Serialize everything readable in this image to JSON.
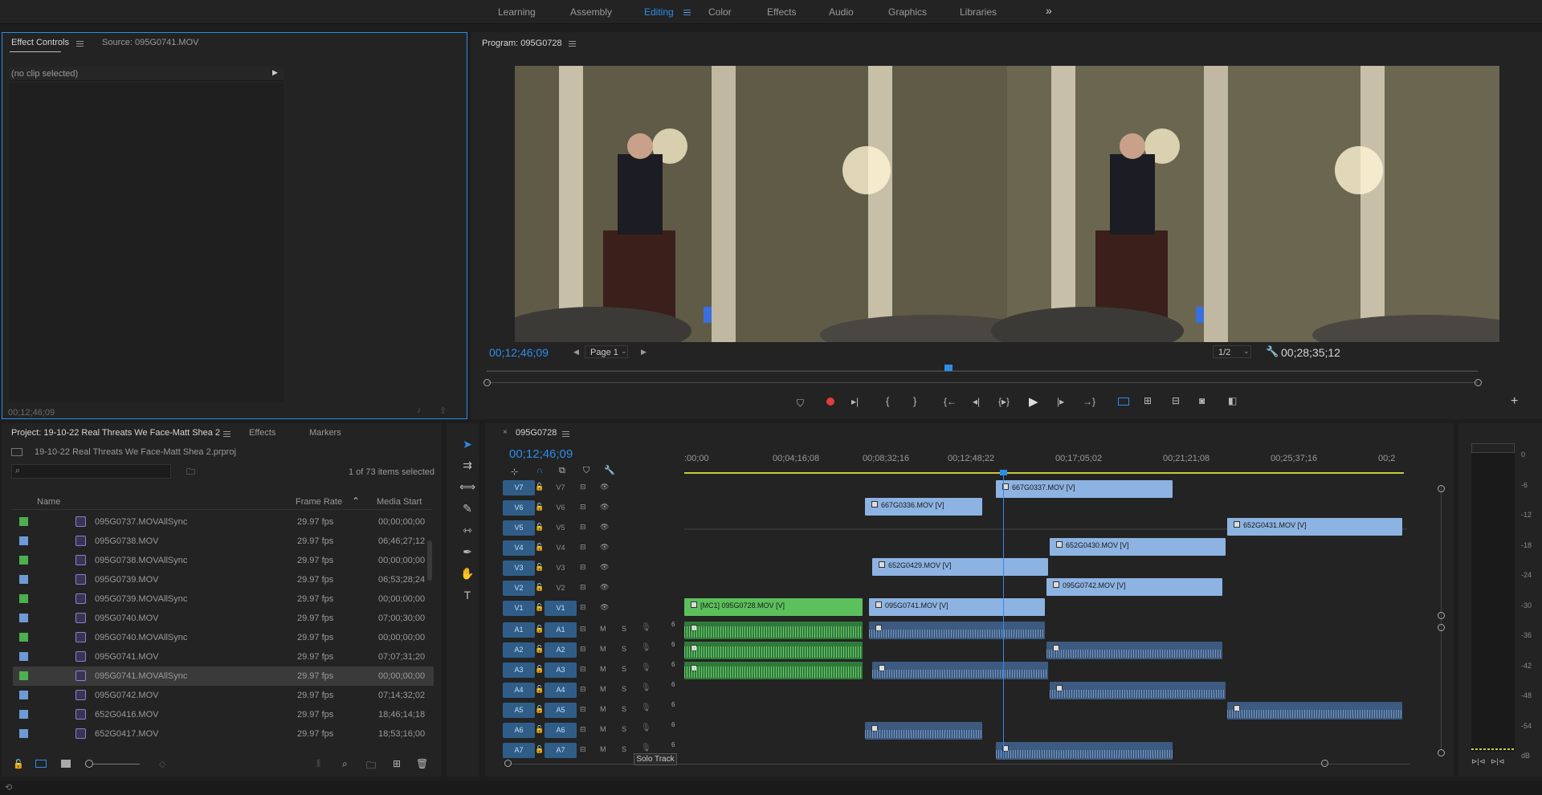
{
  "workspace_tabs": [
    "Learning",
    "Assembly",
    "Editing",
    "Color",
    "Effects",
    "Audio",
    "Graphics",
    "Libraries"
  ],
  "workspace_active": "Editing",
  "workspace_more": "»",
  "effect_controls": {
    "tab_label": "Effect Controls",
    "source_tab": "Source: 095G0741.MOV",
    "no_clip": "(no clip selected)",
    "timecode": "00;12;46;09"
  },
  "program": {
    "title": "Program: 095G0728",
    "timecode_left": "00;12;46;09",
    "page": "Page 1",
    "resolution": "1/2",
    "timecode_right": "00;28;35;12"
  },
  "project": {
    "tab_label": "Project: 19-10-22 Real Threats We Face-Matt Shea 2",
    "effects_tab": "Effects",
    "markers_tab": "Markers",
    "file_name": "19-10-22 Real Threats We Face-Matt Shea 2.prproj",
    "selected_count": "1 of 73 items selected",
    "columns": {
      "name": "Name",
      "frame_rate": "Frame Rate",
      "media_start": "Media Start"
    },
    "rows": [
      {
        "name": "095G0737.MOVAllSync",
        "fps": "29.97 fps",
        "start": "00;00;00;00",
        "color": "#4caf50",
        "sel": false
      },
      {
        "name": "095G0738.MOV",
        "fps": "29.97 fps",
        "start": "06;46;27;12",
        "color": "#6e9ad6",
        "sel": false
      },
      {
        "name": "095G0738.MOVAllSync",
        "fps": "29.97 fps",
        "start": "00;00;00;00",
        "color": "#4caf50",
        "sel": false
      },
      {
        "name": "095G0739.MOV",
        "fps": "29.97 fps",
        "start": "06;53;28;24",
        "color": "#6e9ad6",
        "sel": false
      },
      {
        "name": "095G0739.MOVAllSync",
        "fps": "29.97 fps",
        "start": "00;00;00;00",
        "color": "#4caf50",
        "sel": false
      },
      {
        "name": "095G0740.MOV",
        "fps": "29.97 fps",
        "start": "07;00;30;00",
        "color": "#6e9ad6",
        "sel": false
      },
      {
        "name": "095G0740.MOVAllSync",
        "fps": "29.97 fps",
        "start": "00;00;00;00",
        "color": "#4caf50",
        "sel": false
      },
      {
        "name": "095G0741.MOV",
        "fps": "29.97 fps",
        "start": "07;07;31;20",
        "color": "#6e9ad6",
        "sel": false
      },
      {
        "name": "095G0741.MOVAllSync",
        "fps": "29.97 fps",
        "start": "00;00;00;00",
        "color": "#4caf50",
        "sel": true
      },
      {
        "name": "095G0742.MOV",
        "fps": "29.97 fps",
        "start": "07;14;32;02",
        "color": "#6e9ad6",
        "sel": false
      },
      {
        "name": "652G0416.MOV",
        "fps": "29.97 fps",
        "start": "18;46;14;18",
        "color": "#6e9ad6",
        "sel": false
      },
      {
        "name": "652G0417.MOV",
        "fps": "29.97 fps",
        "start": "18;53;16;00",
        "color": "#6e9ad6",
        "sel": false
      }
    ]
  },
  "timeline": {
    "tab_label": "095G0728",
    "timecode": "00;12;46;09",
    "ruler": [
      ":00;00",
      "00;04;16;08",
      "00;08;32;16",
      "00;12;48;22",
      "00;17;05;02",
      "00;21;21;08",
      "00;25;37;16",
      "00;2"
    ],
    "video_tracks": [
      "V7",
      "V6",
      "V5",
      "V4",
      "V3",
      "V2",
      "V1"
    ],
    "audio_tracks": [
      "A1",
      "A2",
      "A3",
      "A4",
      "A5",
      "A6",
      "A7"
    ],
    "mute_label": "M",
    "solo_label": "S",
    "vol_label": "6",
    "tooltip": "Solo Track",
    "clips": {
      "v7": "667G0337.MOV [V]",
      "v6": "667G0336.MOV [V]",
      "v5": "652G0431.MOV [V]",
      "v4": "652G0430.MOV [V]",
      "v3": "652G0429.MOV [V]",
      "v2": "095G0742.MOV [V]",
      "v1a": "[MC1] 095G0728.MOV [V]",
      "v1b": "095G0741.MOV [V]"
    }
  },
  "meter": {
    "labels": [
      "0",
      "-6",
      "-12",
      "-18",
      "-24",
      "-30",
      "-36",
      "-42",
      "-48",
      "-54",
      "dB"
    ]
  },
  "colors": {
    "accent": "#2d8ceb",
    "video_clip": "#8db3e2",
    "multicam_clip": "#5cc05c",
    "audio_clip": "#3d5a80"
  }
}
